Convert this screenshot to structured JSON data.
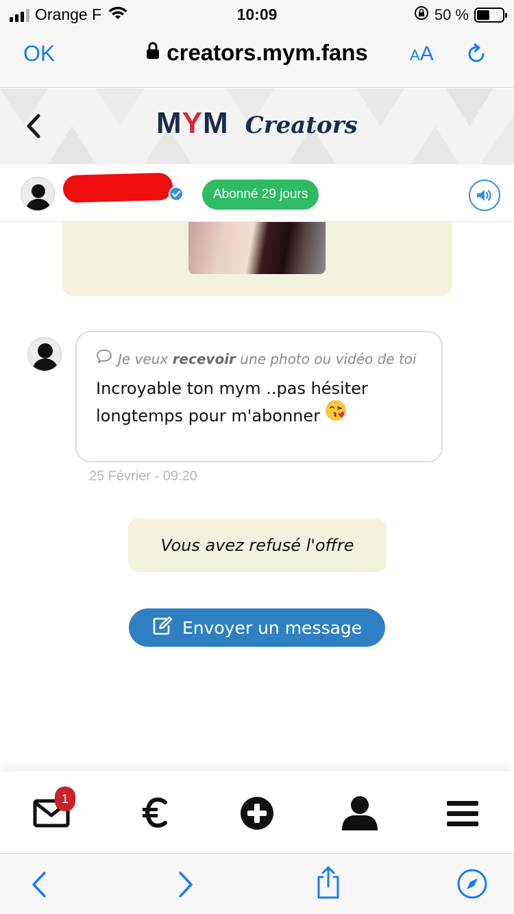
{
  "status_bar": {
    "carrier": "Orange F",
    "time": "10:09",
    "battery_text": "50 %",
    "battery_level": 0.5
  },
  "browser": {
    "done_label": "OK",
    "url": "creators.mym.fans",
    "text_size_label_small": "A",
    "text_size_label_big": "A",
    "accent_color": "#1a7cf5"
  },
  "site_header": {
    "logo_m1": "M",
    "logo_y": "Y",
    "logo_m2": "M",
    "logo_subtitle": "Creators"
  },
  "profile_bar": {
    "subscription_badge": "Abonné 29 jours",
    "badge_color": "#2dbb63"
  },
  "chat": {
    "message": {
      "quote_prefix": "Je veux ",
      "quote_bold": "recevoir",
      "quote_suffix": " une photo ou vidéo de toi",
      "text": "Incroyable ton mym ..pas hésiter longtemps pour m'abonner",
      "timestamp": "25 Février - 09:20"
    },
    "offer_status": "Vous avez refusé l'offre",
    "send_button_label": "Envoyer un message"
  },
  "app_nav": {
    "items": [
      "messages-icon",
      "euro-icon",
      "plus-circle-icon",
      "user-icon",
      "menu-icon"
    ],
    "messages_badge": "1"
  },
  "safari_toolbar": {
    "items": [
      "back-arrow-icon",
      "forward-arrow-icon",
      "share-icon",
      "compass-icon"
    ]
  }
}
